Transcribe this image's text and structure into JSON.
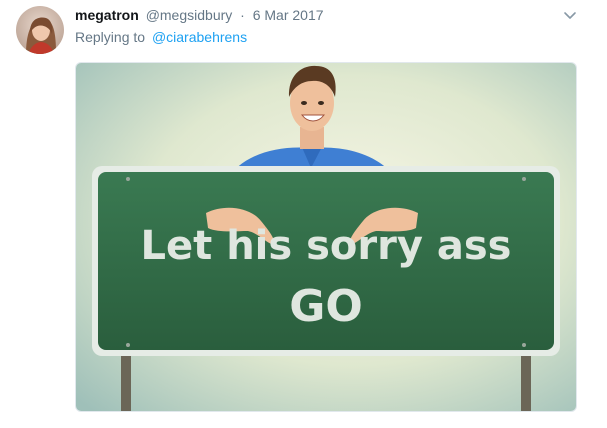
{
  "tweet": {
    "display_name": "megatron",
    "handle": "@megsidbury",
    "separator": "·",
    "date": "6 Mar 2017",
    "replying_prefix": "Replying to",
    "replying_to": "@ciarabehrens"
  },
  "icons": {
    "menu": "chevron-down-icon",
    "avatar": "avatar"
  },
  "media": {
    "sign_line1": "Let his sorry ass",
    "sign_line2": "GO",
    "sign_color": "#2f6a45",
    "sign_text_color": "#dfe6df"
  },
  "colors": {
    "link": "#1da1f2",
    "muted": "#657786",
    "text": "#14171a"
  }
}
